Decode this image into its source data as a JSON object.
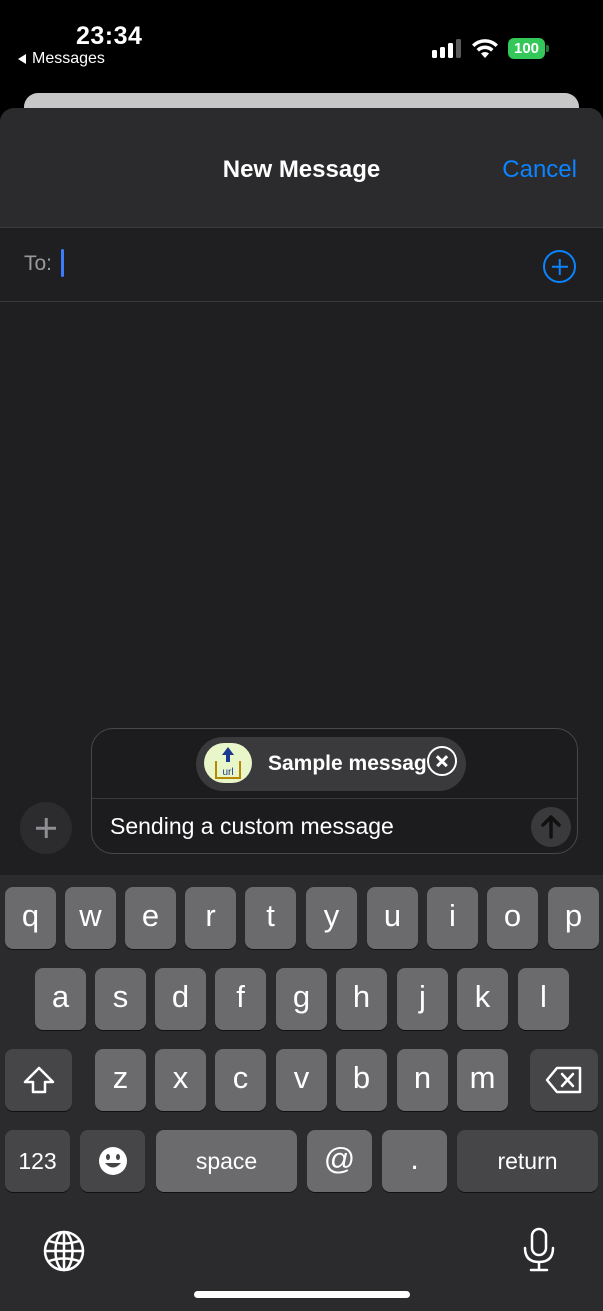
{
  "status_bar": {
    "time": "23:34",
    "back_app": "Messages",
    "battery": "100",
    "battery_color": "#34c759"
  },
  "nav": {
    "title": "New Message",
    "cancel_label": "Cancel",
    "accent_color": "#0a84ff"
  },
  "recipient": {
    "label": "To:",
    "value": "",
    "add_icon": "plus-circle-icon"
  },
  "compose": {
    "attachment_title": "Sample message",
    "attachment_thumbnail_text": "url",
    "message_text": "Sending a custom message",
    "plus_icon": "plus-icon",
    "send_icon": "arrow-up-icon"
  },
  "keyboard": {
    "row1": [
      "q",
      "w",
      "e",
      "r",
      "t",
      "y",
      "u",
      "i",
      "o",
      "p"
    ],
    "row2": [
      "a",
      "s",
      "d",
      "f",
      "g",
      "h",
      "j",
      "k",
      "l"
    ],
    "row3": [
      "z",
      "x",
      "c",
      "v",
      "b",
      "n",
      "m"
    ],
    "numbers_label": "123",
    "space_label": "space",
    "at_label": "@",
    "period_label": ".",
    "return_label": "return",
    "shift_icon": "shift-icon",
    "delete_icon": "delete-icon",
    "emoji_icon": "emoji-icon",
    "globe_icon": "globe-icon",
    "mic_icon": "microphone-icon"
  }
}
